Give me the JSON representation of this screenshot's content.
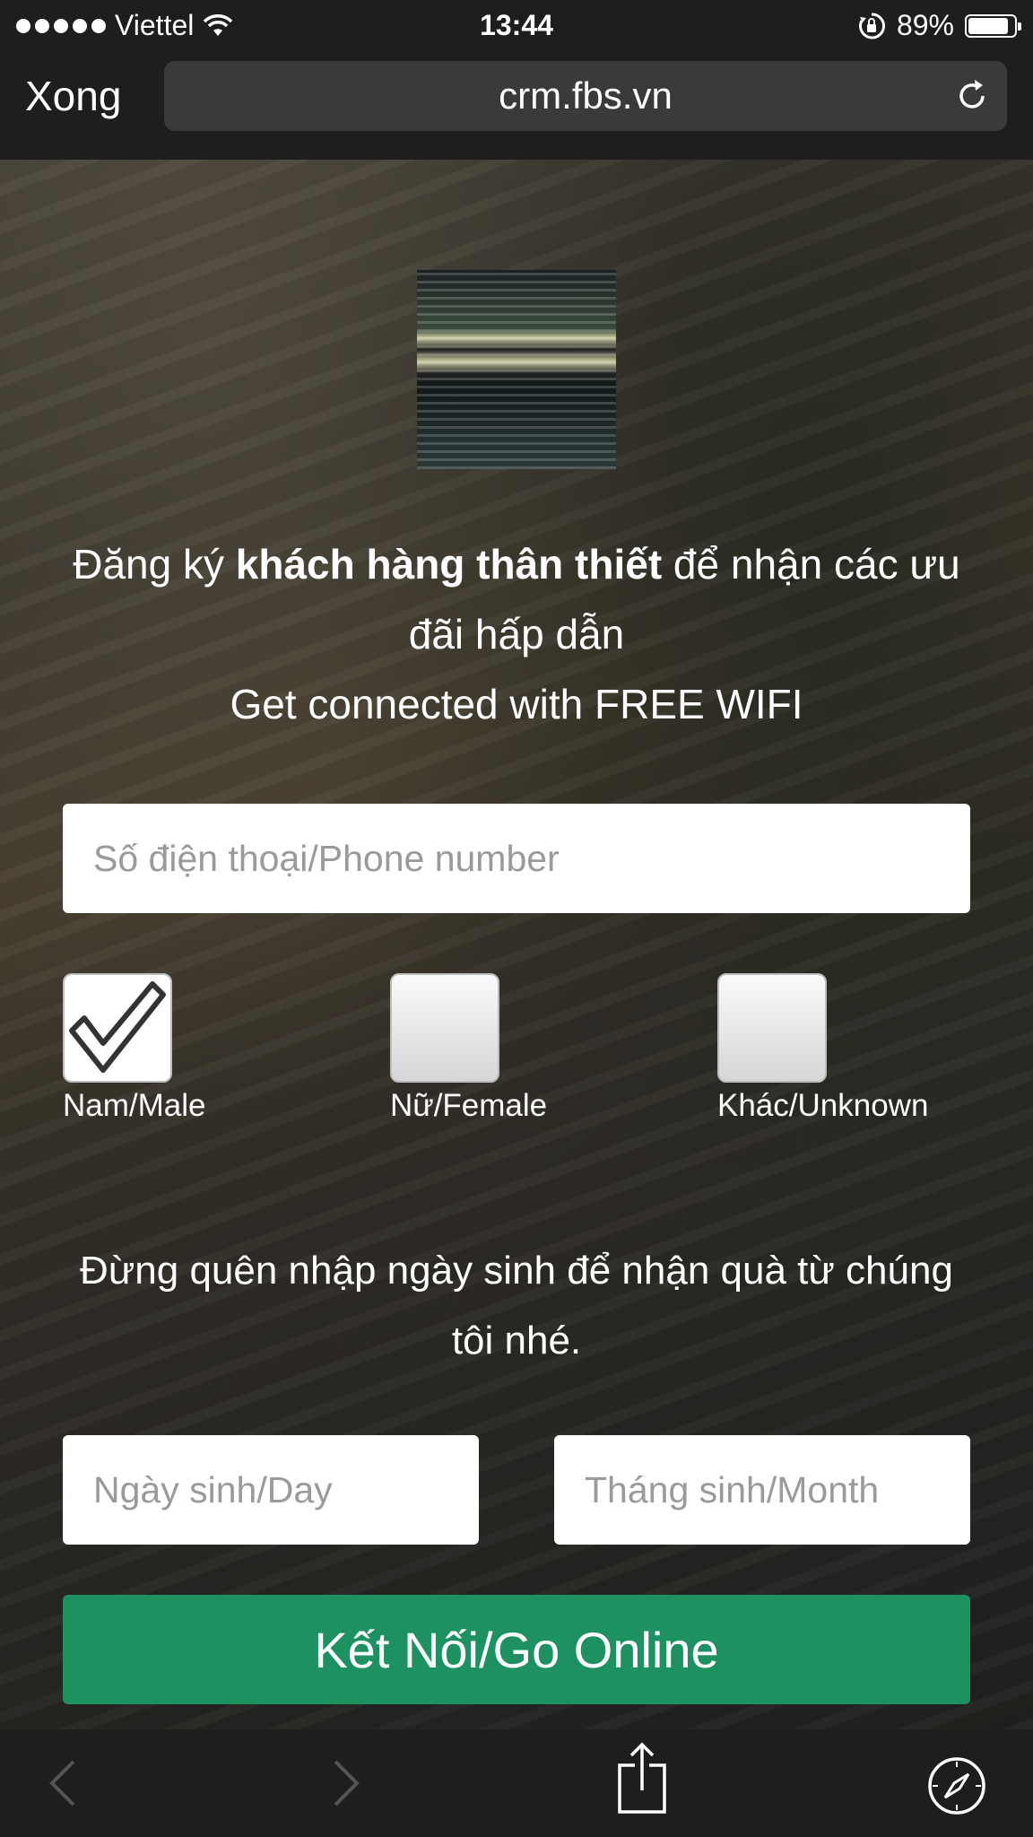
{
  "status_bar": {
    "carrier": "Viettel",
    "time": "13:44",
    "battery_percent_label": "89%",
    "battery_level": 0.89
  },
  "browser": {
    "done_label": "Xong",
    "url": "crm.fbs.vn"
  },
  "page": {
    "headline": {
      "prefix": "Đăng ký ",
      "bold": "khách hàng thân thiết",
      "suffix": " để nhận các ưu đãi hấp dẫn",
      "line2": "Get connected with FREE WIFI"
    },
    "phone_placeholder": "Số điện thoại/Phone number",
    "gender_options": [
      {
        "label": "Nam/Male",
        "checked": true
      },
      {
        "label": "Nữ/Female",
        "checked": false
      },
      {
        "label": "Khác/Unknown",
        "checked": false
      }
    ],
    "birthday_reminder": "Đừng quên nhập ngày sinh để nhận quà từ chúng tôi nhé.",
    "day_placeholder": "Ngày sinh/Day",
    "month_placeholder": "Tháng sinh/Month",
    "submit_label": "Kết Nối/Go Online"
  },
  "toolbar": {
    "icons": [
      "back-arrow-icon",
      "forward-arrow-icon",
      "share-icon",
      "safari-compass-icon"
    ]
  },
  "colors": {
    "submit_green": "#1e9160",
    "chrome_dark": "#1e1e1e",
    "url_field": "#3a3a3a"
  }
}
